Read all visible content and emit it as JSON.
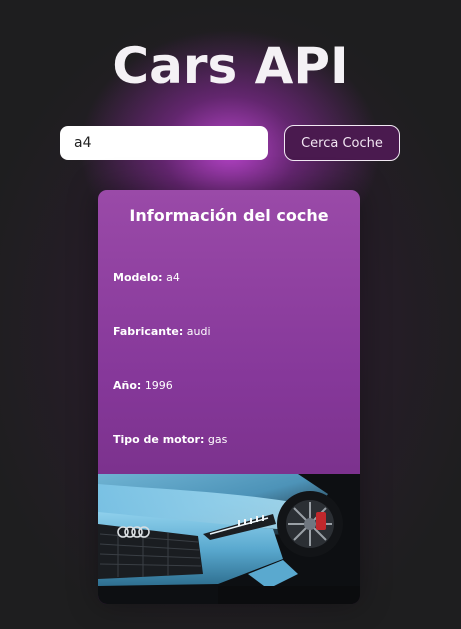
{
  "header": {
    "title": "Cars API"
  },
  "search": {
    "value": "a4",
    "button_label": "Cerca Coche"
  },
  "card": {
    "title": "Información del coche",
    "model_label": "Modelo:",
    "model_value": "a4",
    "maker_label": "Fabricante:",
    "maker_value": "audi",
    "year_label": "Año:",
    "year_value": "1996",
    "engine_label": "Tipo de motor:",
    "engine_value": "gas"
  },
  "colors": {
    "background": "#1e1e1f",
    "accent": "#8e3f9f",
    "glow": "#be46d2",
    "button_bg": "#4a1a4f"
  }
}
